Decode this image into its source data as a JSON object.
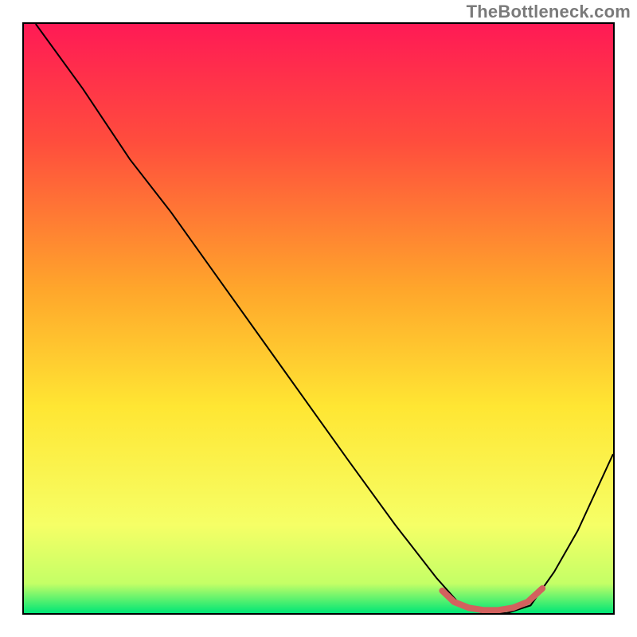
{
  "attribution": "TheBottleneck.com",
  "chart_data": {
    "type": "line",
    "title": "",
    "xlabel": "",
    "ylabel": "",
    "xlim": [
      0,
      100
    ],
    "ylim": [
      0,
      100
    ],
    "gradient_stops": [
      {
        "offset": 0,
        "color": "#ff1a55"
      },
      {
        "offset": 20,
        "color": "#ff4d3d"
      },
      {
        "offset": 45,
        "color": "#ffa62b"
      },
      {
        "offset": 65,
        "color": "#ffe633"
      },
      {
        "offset": 85,
        "color": "#f6ff66"
      },
      {
        "offset": 95,
        "color": "#c4ff66"
      },
      {
        "offset": 100,
        "color": "#00e676"
      }
    ],
    "series": [
      {
        "name": "bottleneck-curve",
        "stroke": "#000000",
        "stroke_width": 2,
        "x": [
          2,
          10,
          18,
          25,
          35,
          45,
          55,
          63,
          70,
          74,
          78,
          82,
          86,
          90,
          94,
          100
        ],
        "y": [
          100,
          89,
          77,
          68,
          54,
          40,
          26,
          15,
          6,
          1.5,
          0,
          0,
          1.3,
          7,
          14,
          27
        ]
      },
      {
        "name": "sweet-spot-band",
        "stroke": "#d3615e",
        "stroke_width": 8,
        "linecap": "round",
        "x": [
          71,
          73,
          75.5,
          78,
          80.5,
          83,
          85.5,
          88
        ],
        "y": [
          3.8,
          1.9,
          0.9,
          0.5,
          0.5,
          0.9,
          1.9,
          4.2
        ]
      }
    ],
    "annotations": []
  }
}
